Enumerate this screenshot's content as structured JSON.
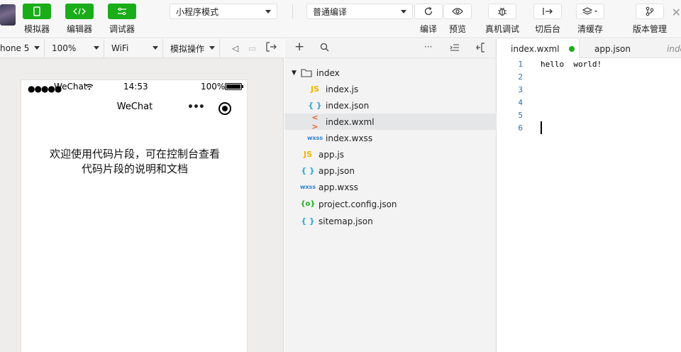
{
  "toolbar": {
    "simulator_label": "模拟器",
    "editor_label": "编辑器",
    "debugger_label": "调试器",
    "mode_value": "小程序模式",
    "compile_mode_value": "普通编译",
    "compile_label": "编译",
    "preview_label": "预览",
    "device_debug_label": "真机调试",
    "background_label": "切后台",
    "clear_cache_label": "清缓存",
    "version_label": "版本管理",
    "accent_color": "#1aad19"
  },
  "simulator": {
    "device_value": "hone 5",
    "zoom_value": "100%",
    "network_value": "WiFi",
    "action_value": "模拟操作",
    "status_bar": {
      "signal": "●●●●●",
      "carrier": "WeChat",
      "time": "14:53",
      "battery": "100%"
    },
    "nav_title": "WeChat",
    "capsule_dots": "•••",
    "welcome_line1": "欢迎使用代码片段，可在控制台查看",
    "welcome_line2": "代码片段的说明和文档"
  },
  "file_tree": {
    "items": [
      {
        "name": "index",
        "icon": "folder-icon"
      },
      {
        "name": "index.js",
        "icon": "JS"
      },
      {
        "name": "index.json",
        "icon": "{ }"
      },
      {
        "name": "index.wxml",
        "icon": "< >"
      },
      {
        "name": "index.wxss",
        "icon": "wxss"
      },
      {
        "name": "app.js",
        "icon": "JS"
      },
      {
        "name": "app.json",
        "icon": "{ }"
      },
      {
        "name": "app.wxss",
        "icon": "wxss"
      },
      {
        "name": "project.config.json",
        "icon": "{o}"
      },
      {
        "name": "sitemap.json",
        "icon": "{ }"
      }
    ],
    "selected": "index.wxml"
  },
  "editor": {
    "tabs": [
      {
        "label": "index.wxml",
        "modified": true
      },
      {
        "label": "app.json",
        "modified": false
      },
      {
        "label": "index",
        "modified": false
      }
    ],
    "line_numbers": [
      "1",
      "2",
      "3",
      "4",
      "5",
      "6"
    ],
    "code_line1": "hello  world!",
    "line_number_color": "#2b6fb6"
  }
}
